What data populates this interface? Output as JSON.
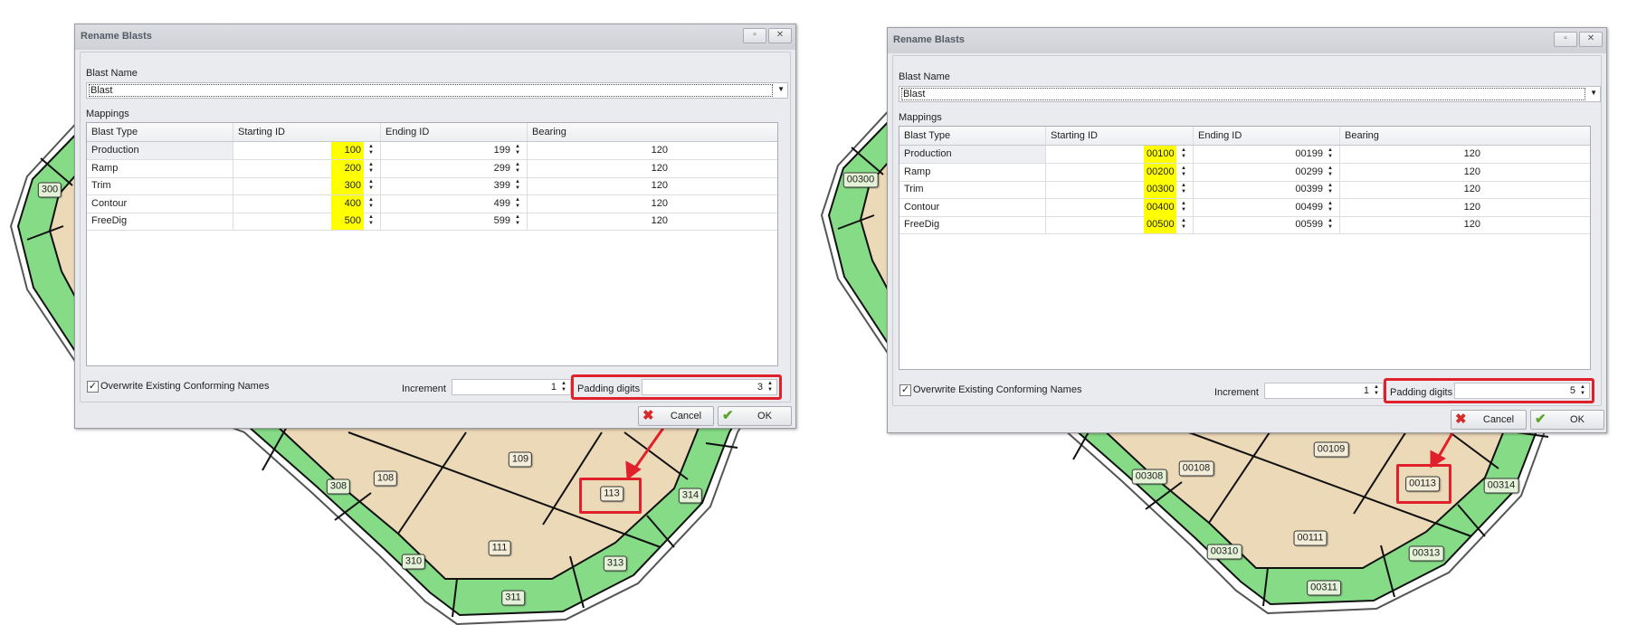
{
  "dialogs": [
    {
      "title": "Rename Blasts",
      "blast_name_label": "Blast Name",
      "blast_name_value": "Blast",
      "mappings_label": "Mappings",
      "columns": [
        "Blast Type",
        "Starting ID",
        "Ending ID",
        "Bearing"
      ],
      "rows": [
        {
          "type": "Production",
          "start": "100",
          "end": "199",
          "bearing": "120"
        },
        {
          "type": "Ramp",
          "start": "200",
          "end": "299",
          "bearing": "120"
        },
        {
          "type": "Trim",
          "start": "300",
          "end": "399",
          "bearing": "120"
        },
        {
          "type": "Contour",
          "start": "400",
          "end": "499",
          "bearing": "120"
        },
        {
          "type": "FreeDig",
          "start": "500",
          "end": "599",
          "bearing": "120"
        }
      ],
      "overwrite_label": "Overwrite Existing Conforming Names",
      "overwrite_checked": true,
      "increment_label": "Increment",
      "increment_value": "1",
      "padding_label": "Padding digits",
      "padding_value": "3",
      "cancel_label": "Cancel",
      "ok_label": "OK"
    },
    {
      "title": "Rename Blasts",
      "blast_name_label": "Blast Name",
      "blast_name_value": "Blast",
      "mappings_label": "Mappings",
      "columns": [
        "Blast Type",
        "Starting ID",
        "Ending ID",
        "Bearing"
      ],
      "rows": [
        {
          "type": "Production",
          "start": "00100",
          "end": "00199",
          "bearing": "120"
        },
        {
          "type": "Ramp",
          "start": "00200",
          "end": "00299",
          "bearing": "120"
        },
        {
          "type": "Trim",
          "start": "00300",
          "end": "00399",
          "bearing": "120"
        },
        {
          "type": "Contour",
          "start": "00400",
          "end": "00499",
          "bearing": "120"
        },
        {
          "type": "FreeDig",
          "start": "00500",
          "end": "00599",
          "bearing": "120"
        }
      ],
      "overwrite_label": "Overwrite Existing Conforming Names",
      "overwrite_checked": true,
      "increment_label": "Increment",
      "increment_value": "1",
      "padding_label": "Padding digits",
      "padding_value": "5",
      "cancel_label": "Cancel",
      "ok_label": "OK"
    }
  ],
  "maps": [
    {
      "labels": [
        "300",
        "308",
        "108",
        "109",
        "113",
        "314",
        "111",
        "310",
        "313",
        "311"
      ]
    },
    {
      "labels": [
        "00300",
        "00308",
        "00108",
        "00109",
        "00113",
        "00314",
        "00111",
        "00310",
        "00313",
        "00311"
      ]
    }
  ],
  "colors": {
    "highlight": "#ffff00",
    "annotation": "#e0202a",
    "ring": "#86dc86",
    "ground": "#ecd9b8"
  }
}
